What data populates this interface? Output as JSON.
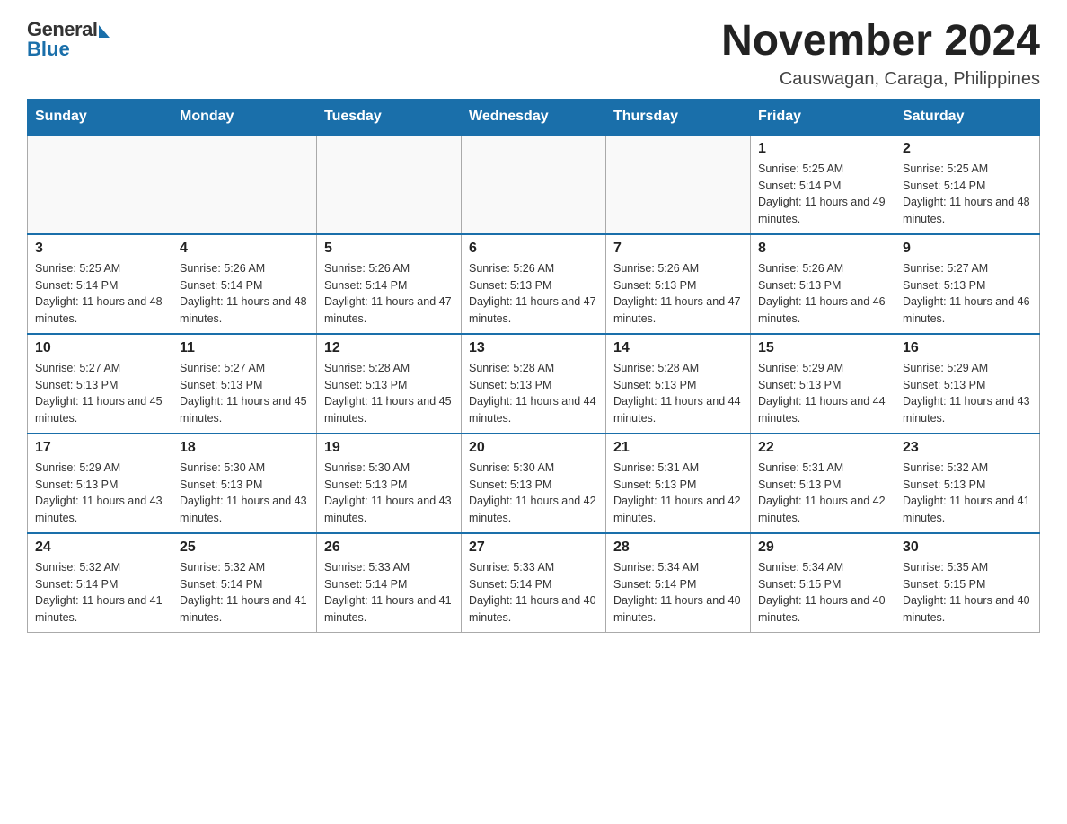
{
  "logo": {
    "general": "General",
    "blue": "Blue"
  },
  "title": {
    "month_year": "November 2024",
    "location": "Causwagan, Caraga, Philippines"
  },
  "days_header": [
    "Sunday",
    "Monday",
    "Tuesday",
    "Wednesday",
    "Thursday",
    "Friday",
    "Saturday"
  ],
  "weeks": [
    [
      {
        "day": "",
        "sunrise": "",
        "sunset": "",
        "daylight": ""
      },
      {
        "day": "",
        "sunrise": "",
        "sunset": "",
        "daylight": ""
      },
      {
        "day": "",
        "sunrise": "",
        "sunset": "",
        "daylight": ""
      },
      {
        "day": "",
        "sunrise": "",
        "sunset": "",
        "daylight": ""
      },
      {
        "day": "",
        "sunrise": "",
        "sunset": "",
        "daylight": ""
      },
      {
        "day": "1",
        "sunrise": "Sunrise: 5:25 AM",
        "sunset": "Sunset: 5:14 PM",
        "daylight": "Daylight: 11 hours and 49 minutes."
      },
      {
        "day": "2",
        "sunrise": "Sunrise: 5:25 AM",
        "sunset": "Sunset: 5:14 PM",
        "daylight": "Daylight: 11 hours and 48 minutes."
      }
    ],
    [
      {
        "day": "3",
        "sunrise": "Sunrise: 5:25 AM",
        "sunset": "Sunset: 5:14 PM",
        "daylight": "Daylight: 11 hours and 48 minutes."
      },
      {
        "day": "4",
        "sunrise": "Sunrise: 5:26 AM",
        "sunset": "Sunset: 5:14 PM",
        "daylight": "Daylight: 11 hours and 48 minutes."
      },
      {
        "day": "5",
        "sunrise": "Sunrise: 5:26 AM",
        "sunset": "Sunset: 5:14 PM",
        "daylight": "Daylight: 11 hours and 47 minutes."
      },
      {
        "day": "6",
        "sunrise": "Sunrise: 5:26 AM",
        "sunset": "Sunset: 5:13 PM",
        "daylight": "Daylight: 11 hours and 47 minutes."
      },
      {
        "day": "7",
        "sunrise": "Sunrise: 5:26 AM",
        "sunset": "Sunset: 5:13 PM",
        "daylight": "Daylight: 11 hours and 47 minutes."
      },
      {
        "day": "8",
        "sunrise": "Sunrise: 5:26 AM",
        "sunset": "Sunset: 5:13 PM",
        "daylight": "Daylight: 11 hours and 46 minutes."
      },
      {
        "day": "9",
        "sunrise": "Sunrise: 5:27 AM",
        "sunset": "Sunset: 5:13 PM",
        "daylight": "Daylight: 11 hours and 46 minutes."
      }
    ],
    [
      {
        "day": "10",
        "sunrise": "Sunrise: 5:27 AM",
        "sunset": "Sunset: 5:13 PM",
        "daylight": "Daylight: 11 hours and 45 minutes."
      },
      {
        "day": "11",
        "sunrise": "Sunrise: 5:27 AM",
        "sunset": "Sunset: 5:13 PM",
        "daylight": "Daylight: 11 hours and 45 minutes."
      },
      {
        "day": "12",
        "sunrise": "Sunrise: 5:28 AM",
        "sunset": "Sunset: 5:13 PM",
        "daylight": "Daylight: 11 hours and 45 minutes."
      },
      {
        "day": "13",
        "sunrise": "Sunrise: 5:28 AM",
        "sunset": "Sunset: 5:13 PM",
        "daylight": "Daylight: 11 hours and 44 minutes."
      },
      {
        "day": "14",
        "sunrise": "Sunrise: 5:28 AM",
        "sunset": "Sunset: 5:13 PM",
        "daylight": "Daylight: 11 hours and 44 minutes."
      },
      {
        "day": "15",
        "sunrise": "Sunrise: 5:29 AM",
        "sunset": "Sunset: 5:13 PM",
        "daylight": "Daylight: 11 hours and 44 minutes."
      },
      {
        "day": "16",
        "sunrise": "Sunrise: 5:29 AM",
        "sunset": "Sunset: 5:13 PM",
        "daylight": "Daylight: 11 hours and 43 minutes."
      }
    ],
    [
      {
        "day": "17",
        "sunrise": "Sunrise: 5:29 AM",
        "sunset": "Sunset: 5:13 PM",
        "daylight": "Daylight: 11 hours and 43 minutes."
      },
      {
        "day": "18",
        "sunrise": "Sunrise: 5:30 AM",
        "sunset": "Sunset: 5:13 PM",
        "daylight": "Daylight: 11 hours and 43 minutes."
      },
      {
        "day": "19",
        "sunrise": "Sunrise: 5:30 AM",
        "sunset": "Sunset: 5:13 PM",
        "daylight": "Daylight: 11 hours and 43 minutes."
      },
      {
        "day": "20",
        "sunrise": "Sunrise: 5:30 AM",
        "sunset": "Sunset: 5:13 PM",
        "daylight": "Daylight: 11 hours and 42 minutes."
      },
      {
        "day": "21",
        "sunrise": "Sunrise: 5:31 AM",
        "sunset": "Sunset: 5:13 PM",
        "daylight": "Daylight: 11 hours and 42 minutes."
      },
      {
        "day": "22",
        "sunrise": "Sunrise: 5:31 AM",
        "sunset": "Sunset: 5:13 PM",
        "daylight": "Daylight: 11 hours and 42 minutes."
      },
      {
        "day": "23",
        "sunrise": "Sunrise: 5:32 AM",
        "sunset": "Sunset: 5:13 PM",
        "daylight": "Daylight: 11 hours and 41 minutes."
      }
    ],
    [
      {
        "day": "24",
        "sunrise": "Sunrise: 5:32 AM",
        "sunset": "Sunset: 5:14 PM",
        "daylight": "Daylight: 11 hours and 41 minutes."
      },
      {
        "day": "25",
        "sunrise": "Sunrise: 5:32 AM",
        "sunset": "Sunset: 5:14 PM",
        "daylight": "Daylight: 11 hours and 41 minutes."
      },
      {
        "day": "26",
        "sunrise": "Sunrise: 5:33 AM",
        "sunset": "Sunset: 5:14 PM",
        "daylight": "Daylight: 11 hours and 41 minutes."
      },
      {
        "day": "27",
        "sunrise": "Sunrise: 5:33 AM",
        "sunset": "Sunset: 5:14 PM",
        "daylight": "Daylight: 11 hours and 40 minutes."
      },
      {
        "day": "28",
        "sunrise": "Sunrise: 5:34 AM",
        "sunset": "Sunset: 5:14 PM",
        "daylight": "Daylight: 11 hours and 40 minutes."
      },
      {
        "day": "29",
        "sunrise": "Sunrise: 5:34 AM",
        "sunset": "Sunset: 5:15 PM",
        "daylight": "Daylight: 11 hours and 40 minutes."
      },
      {
        "day": "30",
        "sunrise": "Sunrise: 5:35 AM",
        "sunset": "Sunset: 5:15 PM",
        "daylight": "Daylight: 11 hours and 40 minutes."
      }
    ]
  ]
}
